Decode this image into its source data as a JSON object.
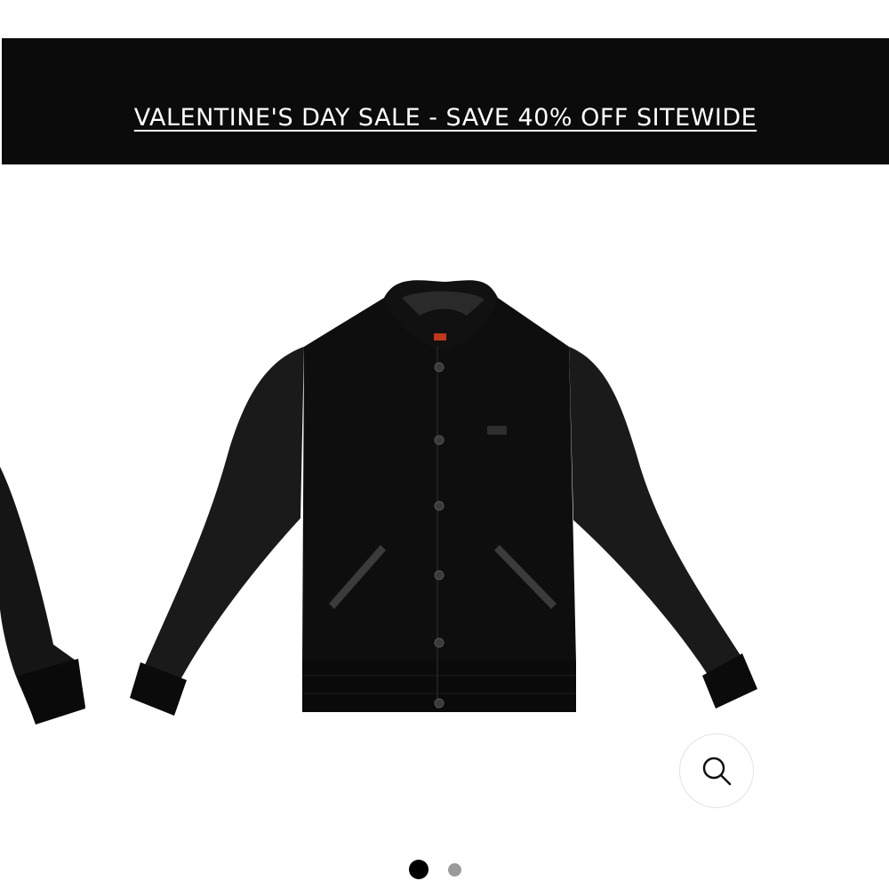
{
  "promo": {
    "text": "VALENTINE'S DAY SALE - SAVE 40% OFF SITEWIDE",
    "background_color": "#0b0b0b",
    "text_color": "#ffffff"
  },
  "gallery": {
    "product_image_subject": "black varsity jacket with leather sleeves",
    "zoom_icon": "magnifying-glass-icon",
    "slides": [
      {
        "active": true
      },
      {
        "active": false
      }
    ],
    "active_dot_color": "#000000",
    "inactive_dot_color": "#9a9a9a"
  }
}
